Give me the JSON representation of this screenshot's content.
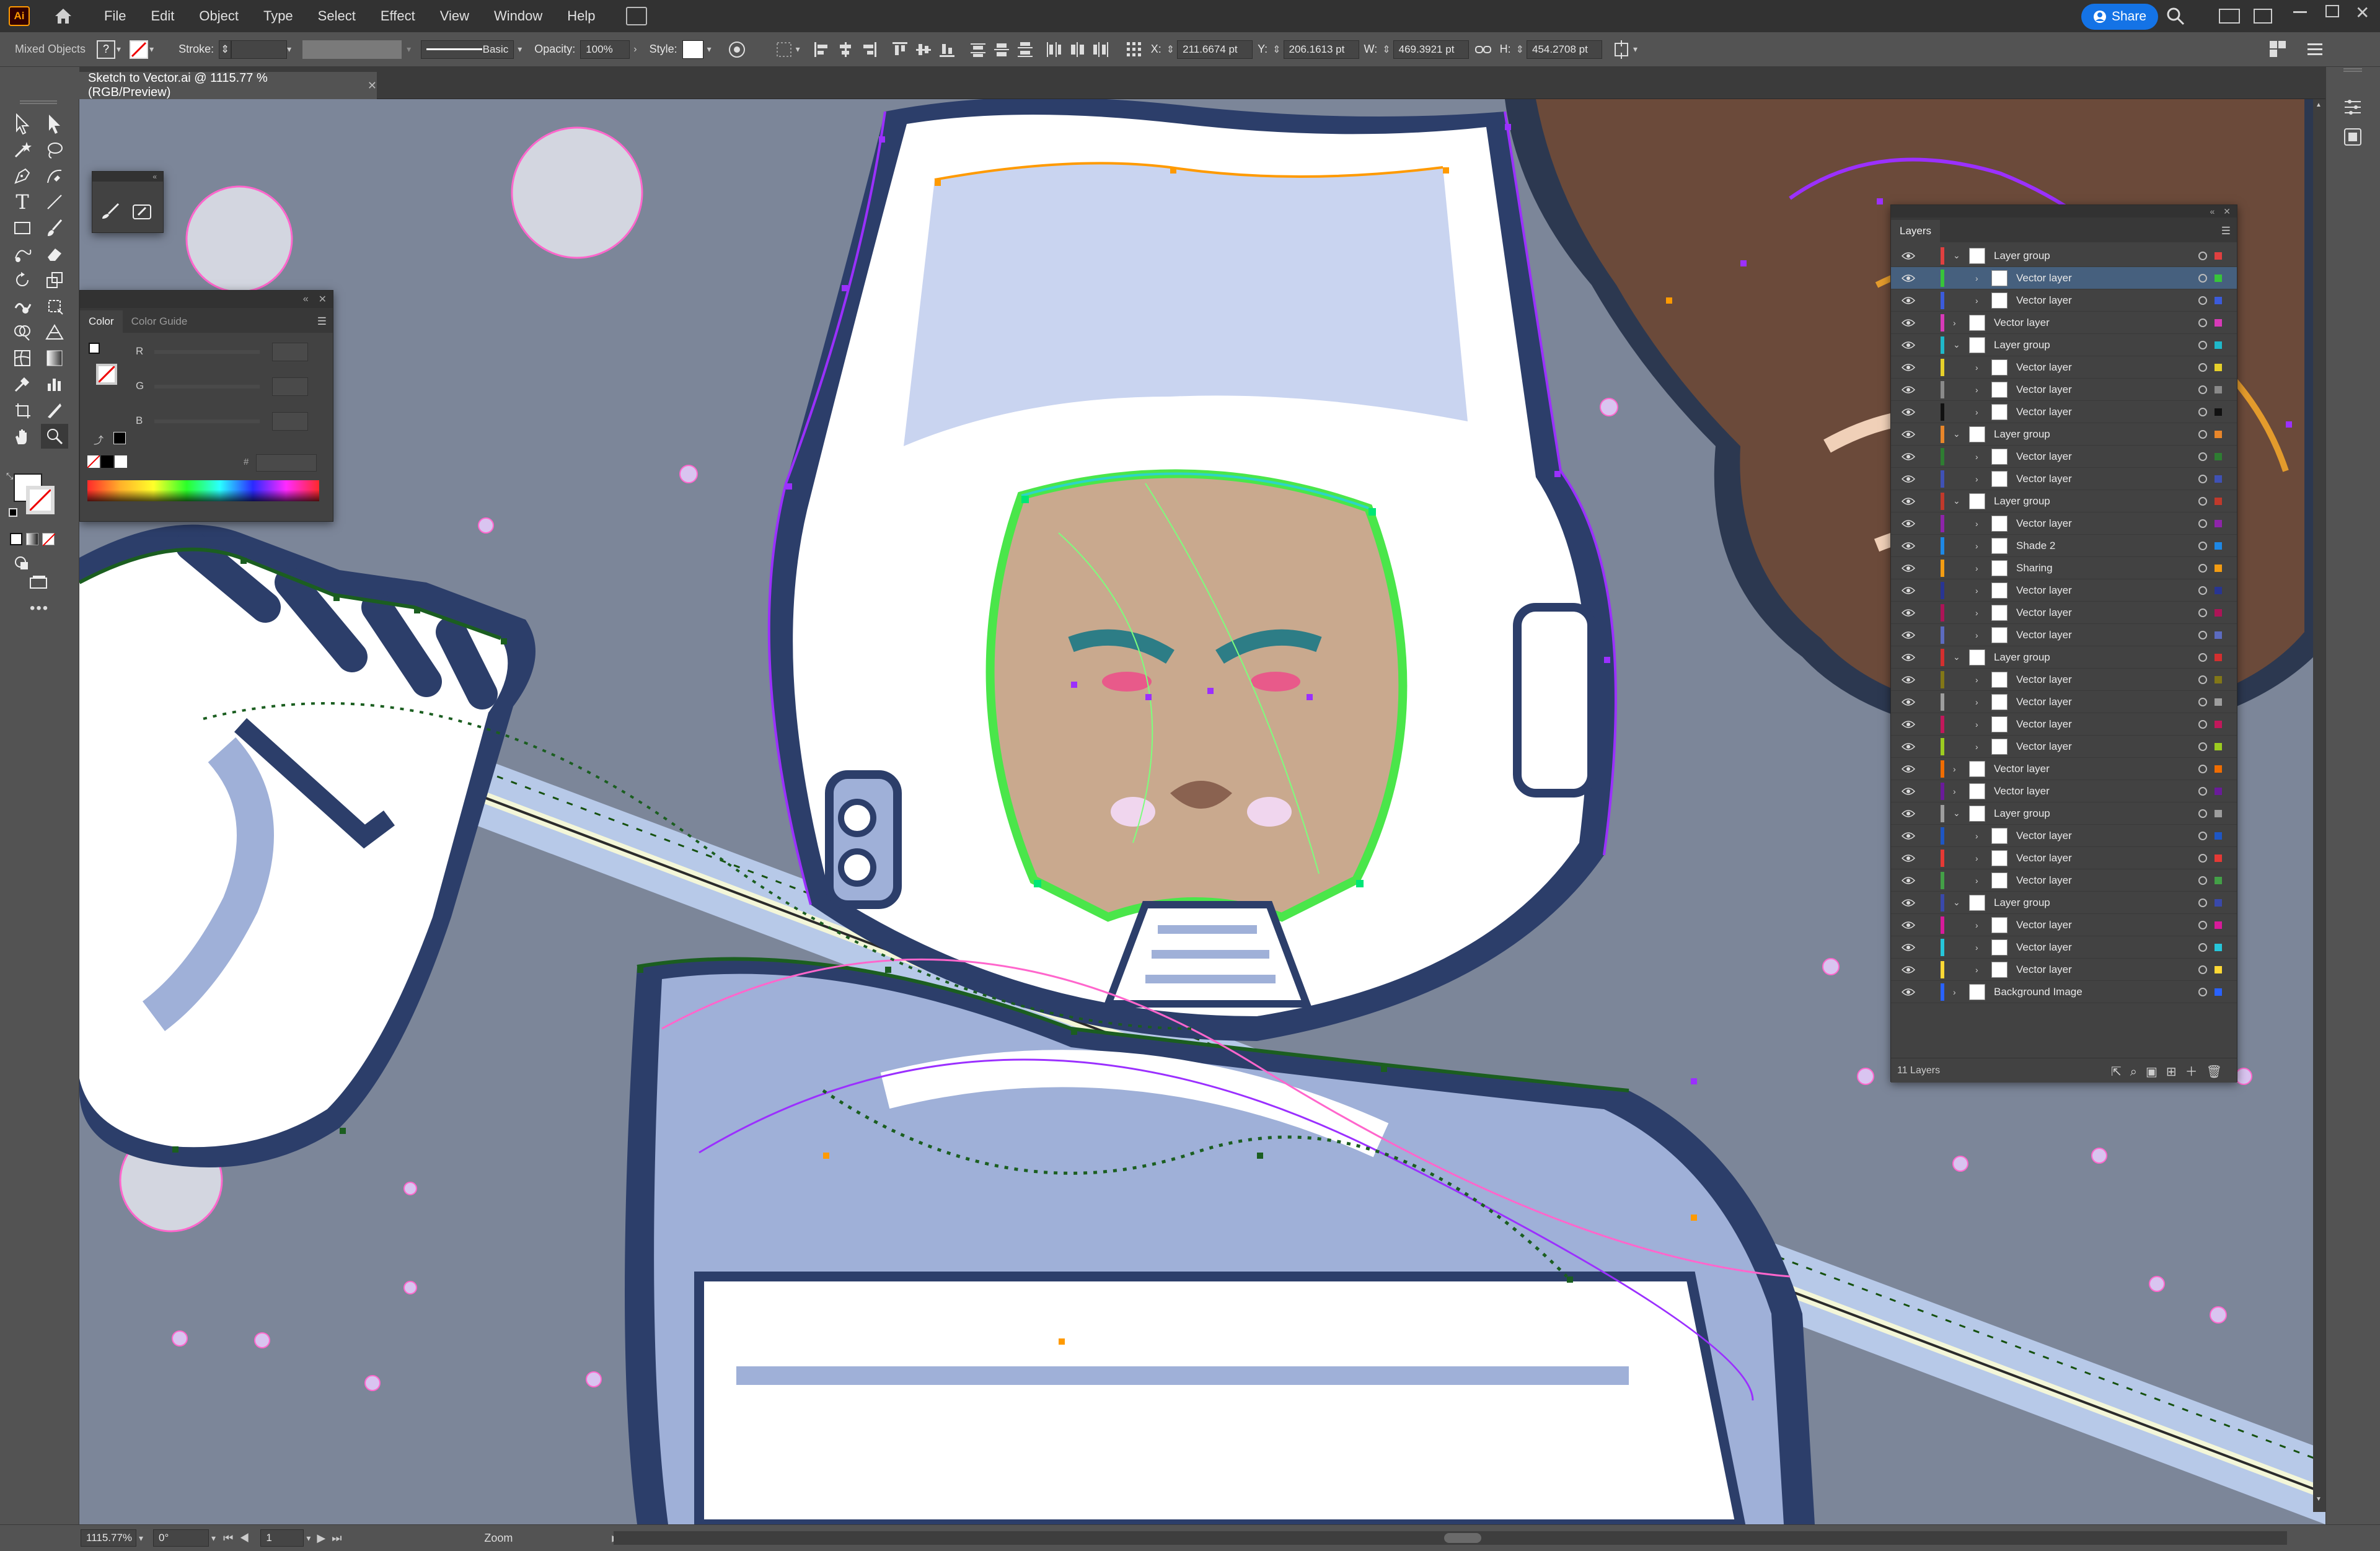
{
  "app": {
    "logo": "Ai",
    "accent": "#ff9a00"
  },
  "menu": {
    "items": [
      "File",
      "Edit",
      "Object",
      "Type",
      "Select",
      "Effect",
      "View",
      "Window",
      "Help"
    ]
  },
  "share": {
    "label": "Share",
    "color": "#1473e6"
  },
  "control_bar": {
    "selection_label": "Mixed Objects",
    "stroke_label": "Stroke:",
    "brush_style": "Basic",
    "opacity_label": "Opacity:",
    "opacity_value": "100%",
    "style_label": "Style:",
    "x_label": "X:",
    "x_value": "211.6674 pt",
    "y_label": "Y:",
    "y_value": "206.1613 pt",
    "w_label": "W:",
    "w_value": "469.3921 pt",
    "h_label": "H:",
    "h_value": "454.2708 pt"
  },
  "document": {
    "tab_title": "Sketch to Vector.ai @ 1115.77 % (RGB/Preview)",
    "close_icon": "close-icon"
  },
  "color_panel": {
    "tabs": [
      "Color",
      "Color Guide"
    ],
    "channels": [
      "R",
      "G",
      "B"
    ],
    "hex_label": "#",
    "fill_color": "#ffffff",
    "spectrum": "rainbow"
  },
  "layers_panel": {
    "title": "Layers",
    "footer_count": "11 Layers",
    "rows": [
      {
        "name": "Layer group",
        "level": 0,
        "expanded": true,
        "color": "#e04040",
        "target": "#e04040",
        "selected": false
      },
      {
        "name": "Vector layer",
        "level": 1,
        "expanded": false,
        "color": "#38c43a",
        "target": "#38c43a",
        "selected": true
      },
      {
        "name": "Vector layer",
        "level": 1,
        "expanded": false,
        "color": "#3b5bdb",
        "target": "#3b5bdb",
        "selected": false
      },
      {
        "name": "Vector layer",
        "level": 0,
        "expanded": false,
        "color": "#d83ab8",
        "target": "#d83ab8",
        "selected": false
      },
      {
        "name": "Layer group",
        "level": 0,
        "expanded": true,
        "color": "#1fb8c9",
        "target": "#1fb8c9",
        "selected": false
      },
      {
        "name": "Vector layer",
        "level": 1,
        "expanded": false,
        "color": "#e6d02a",
        "target": "#e6d02a",
        "selected": false
      },
      {
        "name": "Vector layer",
        "level": 1,
        "expanded": false,
        "color": "#8a8a8a",
        "target": "#8a8a8a",
        "selected": false
      },
      {
        "name": "Vector layer",
        "level": 1,
        "expanded": false,
        "color": "#111111",
        "target": "#111111",
        "selected": false
      },
      {
        "name": "Layer group",
        "level": 0,
        "expanded": true,
        "color": "#e8862a",
        "target": "#e8862a",
        "selected": false
      },
      {
        "name": "Vector layer",
        "level": 1,
        "expanded": false,
        "color": "#2e7d32",
        "target": "#2e7d32",
        "selected": false
      },
      {
        "name": "Vector layer",
        "level": 1,
        "expanded": false,
        "color": "#3f51b5",
        "target": "#3f51b5",
        "selected": false
      },
      {
        "name": "Layer group",
        "level": 0,
        "expanded": true,
        "color": "#c0392b",
        "target": "#c0392b",
        "selected": false
      },
      {
        "name": "Vector layer",
        "level": 1,
        "expanded": false,
        "color": "#8e24aa",
        "target": "#8e24aa",
        "selected": false
      },
      {
        "name": "Shade 2",
        "level": 1,
        "expanded": false,
        "color": "#1e88e5",
        "target": "#1e88e5",
        "selected": false
      },
      {
        "name": "Sharing",
        "level": 1,
        "expanded": false,
        "color": "#f39c12",
        "target": "#f39c12",
        "selected": false
      },
      {
        "name": "Vector layer",
        "level": 1,
        "expanded": false,
        "color": "#283593",
        "target": "#283593",
        "selected": false
      },
      {
        "name": "Vector layer",
        "level": 1,
        "expanded": false,
        "color": "#ad1457",
        "target": "#ad1457",
        "selected": false
      },
      {
        "name": "Vector layer",
        "level": 1,
        "expanded": false,
        "color": "#5c6bc0",
        "target": "#5c6bc0",
        "selected": false
      },
      {
        "name": "Layer group",
        "level": 0,
        "expanded": true,
        "color": "#d32f2f",
        "target": "#d32f2f",
        "selected": false
      },
      {
        "name": "Vector layer",
        "level": 1,
        "expanded": false,
        "color": "#827717",
        "target": "#827717",
        "selected": false
      },
      {
        "name": "Vector layer",
        "level": 1,
        "expanded": false,
        "color": "#9e9e9e",
        "target": "#9e9e9e",
        "selected": false
      },
      {
        "name": "Vector layer",
        "level": 1,
        "expanded": false,
        "color": "#c2185b",
        "target": "#c2185b",
        "selected": false
      },
      {
        "name": "Vector layer",
        "level": 1,
        "expanded": false,
        "color": "#9ccc20",
        "target": "#9ccc20",
        "selected": false
      },
      {
        "name": "Vector layer",
        "level": 0,
        "expanded": false,
        "color": "#ef6c00",
        "target": "#ef6c00",
        "selected": false
      },
      {
        "name": "Vector layer",
        "level": 0,
        "expanded": false,
        "color": "#6a1b9a",
        "target": "#6a1b9a",
        "selected": false
      },
      {
        "name": "Layer group",
        "level": 0,
        "expanded": true,
        "color": "#9e9e9e",
        "target": "#9e9e9e",
        "selected": false
      },
      {
        "name": "Vector layer",
        "level": 1,
        "expanded": false,
        "color": "#1e56c4",
        "target": "#1e56c4",
        "selected": false
      },
      {
        "name": "Vector layer",
        "level": 1,
        "expanded": false,
        "color": "#e53935",
        "target": "#e53935",
        "selected": false
      },
      {
        "name": "Vector layer",
        "level": 1,
        "expanded": false,
        "color": "#43a047",
        "target": "#43a047",
        "selected": false
      },
      {
        "name": "Layer group",
        "level": 0,
        "expanded": true,
        "color": "#3949ab",
        "target": "#3949ab",
        "selected": false
      },
      {
        "name": "Vector layer",
        "level": 1,
        "expanded": false,
        "color": "#d81b9a",
        "target": "#d81b9a",
        "selected": false
      },
      {
        "name": "Vector layer",
        "level": 1,
        "expanded": false,
        "color": "#26c6da",
        "target": "#26c6da",
        "selected": false
      },
      {
        "name": "Vector layer",
        "level": 1,
        "expanded": false,
        "color": "#fdd835",
        "target": "#fdd835",
        "selected": false
      },
      {
        "name": "Background Image",
        "level": 0,
        "expanded": false,
        "color": "#2962ff",
        "target": "#2962ff",
        "selected": false
      }
    ]
  },
  "status_bar": {
    "zoom": "1115.77%",
    "rotation": "0°",
    "artboard": "1",
    "tool": "Zoom"
  },
  "artwork": {
    "background": "#7c8699",
    "anchor_colors": [
      "#9b30ff",
      "#ff9a00",
      "#1b5e20",
      "#ff66cc",
      "#00e676"
    ]
  }
}
